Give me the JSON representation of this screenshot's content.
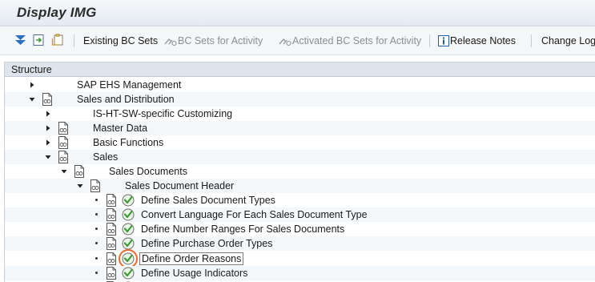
{
  "window": {
    "title": "Display IMG"
  },
  "toolbar": {
    "existing_bc_sets": "Existing BC Sets",
    "bc_sets_for_activity": "BC Sets for Activity",
    "activated_bc_sets_for_activity": "Activated BC Sets for Activity",
    "release_notes": "Release Notes",
    "change_log": "Change Log"
  },
  "tree": {
    "header": "Structure",
    "items": [
      {
        "label": "SAP EHS Management"
      },
      {
        "label": "Sales and Distribution"
      },
      {
        "label": "IS-HT-SW-specific Customizing"
      },
      {
        "label": "Master Data"
      },
      {
        "label": "Basic Functions"
      },
      {
        "label": "Sales"
      },
      {
        "label": "Sales Documents"
      },
      {
        "label": "Sales Document Header"
      },
      {
        "label": "Define Sales Document Types"
      },
      {
        "label": "Convert Language For Each Sales Document Type"
      },
      {
        "label": "Define Number Ranges For Sales Documents"
      },
      {
        "label": "Define Purchase Order Types"
      },
      {
        "label": "Define Order Reasons"
      },
      {
        "label": "Define Usage Indicators"
      }
    ]
  },
  "colors": {
    "highlight_ring": "#e8692a",
    "execute_icon": "#3f9a3a"
  }
}
